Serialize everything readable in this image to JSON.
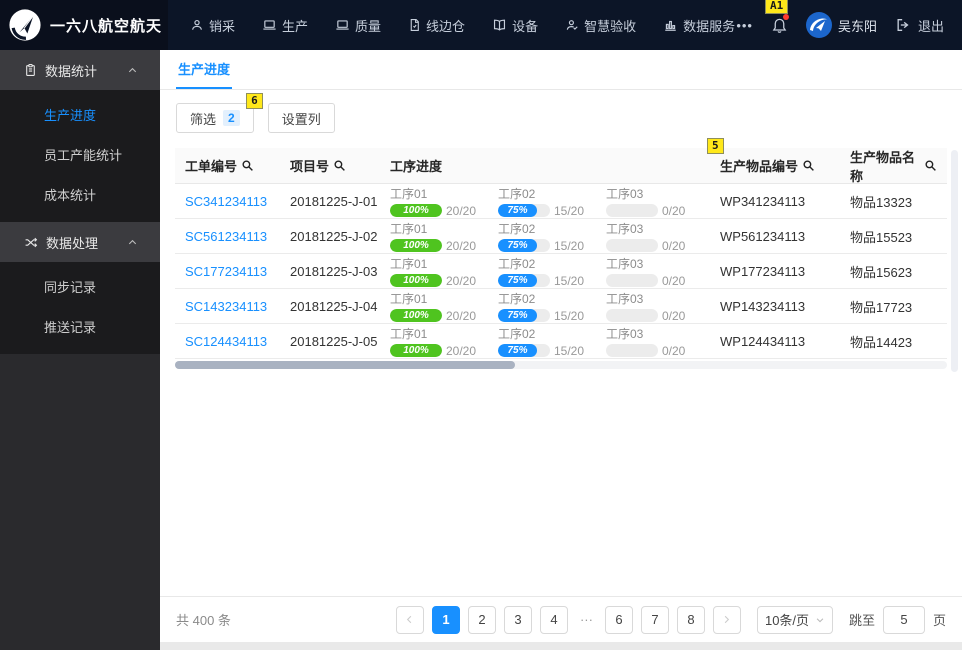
{
  "navbar": {
    "brand": "一六八航空航天",
    "items": [
      {
        "label": "销采",
        "icon": "user-icon"
      },
      {
        "label": "生产",
        "icon": "monitor-icon"
      },
      {
        "label": "质量",
        "icon": "monitor-icon"
      },
      {
        "label": "线边仓",
        "icon": "file-icon"
      },
      {
        "label": "设备",
        "icon": "book-icon"
      },
      {
        "label": "智慧验收",
        "icon": "user-check-icon"
      },
      {
        "label": "数据服务",
        "icon": "chart-icon"
      }
    ],
    "more_label": "•••",
    "notification_mark": "A1",
    "user_name": "吴东阳",
    "logout_label": "退出"
  },
  "sidebar": {
    "groups": [
      {
        "label": "数据统计",
        "icon": "clipboard-icon",
        "items": [
          {
            "label": "生产进度",
            "active": true
          },
          {
            "label": "员工产能统计",
            "active": false
          },
          {
            "label": "成本统计",
            "active": false
          }
        ]
      },
      {
        "label": "数据处理",
        "icon": "shuffle-icon",
        "items": [
          {
            "label": "同步记录",
            "active": false
          },
          {
            "label": "推送记录",
            "active": false
          }
        ]
      }
    ]
  },
  "main": {
    "tab_label": "生产进度",
    "toolbar": {
      "filter_label": "筛选",
      "filter_count": "2",
      "filter_mark": "6",
      "columns_label": "设置列"
    },
    "table": {
      "headers": [
        "工单编号",
        "项目号",
        "工序进度",
        "生产物品编号",
        "生产物品名称"
      ],
      "col4_mark": "5",
      "process_template": [
        {
          "label": "工序01",
          "percent_text": "100%",
          "percent": 100,
          "count": "20/20",
          "color": "#4fc41f"
        },
        {
          "label": "工序02",
          "percent_text": "75%",
          "percent": 75,
          "count": "15/20",
          "color": "#1890ff"
        },
        {
          "label": "工序03",
          "percent_text": "",
          "percent": 0,
          "count": "0/20",
          "color": ""
        }
      ],
      "rows": [
        {
          "order_no": "SC341234113",
          "project_no": "20181225-J-01",
          "item_code": "WP341234113",
          "item_name": "物品13323"
        },
        {
          "order_no": "SC561234113",
          "project_no": "20181225-J-02",
          "item_code": "WP561234113",
          "item_name": "物品15523"
        },
        {
          "order_no": "SC177234113",
          "project_no": "20181225-J-03",
          "item_code": "WP177234113",
          "item_name": "物品15623"
        },
        {
          "order_no": "SC143234113",
          "project_no": "20181225-J-04",
          "item_code": "WP143234113",
          "item_name": "物品17723"
        },
        {
          "order_no": "SC124434113",
          "project_no": "20181225-J-05",
          "item_code": "WP124434113",
          "item_name": "物品14423"
        }
      ]
    },
    "footer": {
      "total_label": "共 400 条",
      "pages": [
        "1",
        "2",
        "3",
        "4",
        "···",
        "6",
        "7",
        "8"
      ],
      "active_page": "1",
      "page_size_label": "10条/页",
      "jump_label": "跳至",
      "jump_value": "5",
      "jump_suffix": "页"
    }
  },
  "colors": {
    "accent": "#1890ff",
    "progress_green": "#4fc41f",
    "progress_blue": "#1890ff",
    "navbar_bg": "#0c1527",
    "mark_bg": "#ffe81a"
  }
}
